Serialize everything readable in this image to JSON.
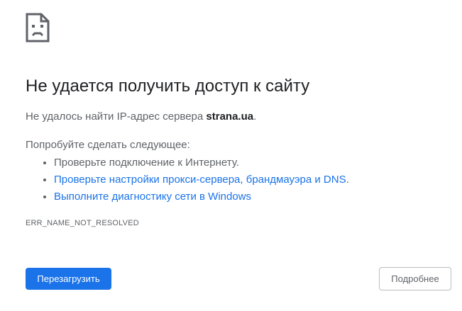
{
  "error": {
    "icon": "sad-page-icon",
    "title": "Не удается получить доступ к сайту",
    "subtitle_prefix": "Не удалось найти IP-адрес сервера ",
    "host": "strana.ua",
    "subtitle_suffix": ".",
    "try_label": "Попробуйте сделать следующее:",
    "suggestions": [
      {
        "text": "Проверьте подключение к Интернету.",
        "is_link": false
      },
      {
        "text": "Проверьте настройки прокси-сервера, брандмауэра и DNS",
        "suffix": ".",
        "is_link": true
      },
      {
        "text": "Выполните диагностику сети в Windows",
        "is_link": true
      }
    ],
    "code": "ERR_NAME_NOT_RESOLVED"
  },
  "buttons": {
    "reload_label": "Перезагрузить",
    "details_label": "Подробнее"
  },
  "colors": {
    "accent": "#1a73e8",
    "text_primary": "#202124",
    "text_secondary": "#5f6368"
  }
}
